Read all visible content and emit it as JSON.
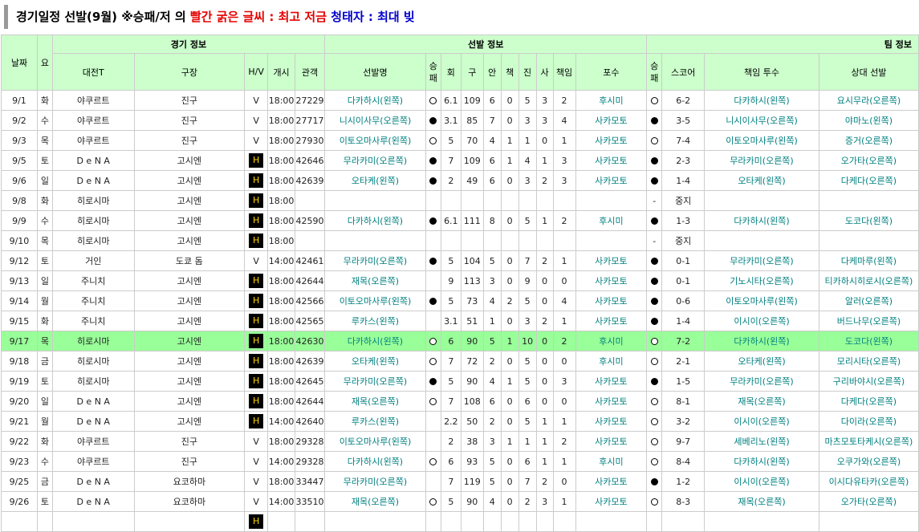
{
  "header": {
    "title_part1": "경기일정 선발(9월) ※승패/저 의 ",
    "title_red": "빨간 굵은 글씨 : 최고 저금",
    "title_part2": " ",
    "title_blue": "청태자 : 최대 빚"
  },
  "table": {
    "group_headers": {
      "date": "날짜",
      "day": "요",
      "game_info": "경기 정보",
      "starter_info": "선발 정보",
      "team_info": "팀 정보"
    },
    "columns": {
      "opponent": "대전T",
      "stadium": "구장",
      "hv": "H/V",
      "start": "개시",
      "attendance": "관객",
      "starter": "선발명",
      "decision": "승패",
      "innings": "회",
      "pitches": "구",
      "hits": "안",
      "er": "책",
      "ks": "진",
      "bb": "사",
      "runs": "책임",
      "catcher": "포수",
      "result": "승패",
      "score": "스코어",
      "resp_pitcher": "책임 투수",
      "opp_starter": "상대 선발"
    },
    "rows": [
      {
        "date": "9/1",
        "day": "화",
        "opp": "야쿠르트",
        "stadium": "진구",
        "hv": "V",
        "start": "18:00",
        "att": "27229",
        "starter": "다카하시(왼쪽)",
        "dec": "win",
        "inn": "6.1",
        "pit": "109",
        "hits": "6",
        "er": "0",
        "k": "5",
        "bb": "3",
        "runs": "2",
        "catcher": "후시미",
        "res": "win",
        "score": "6-2",
        "resp": "다카하시(왼쪽)",
        "opp_starter": "요시무라(오른쪽)"
      },
      {
        "date": "9/2",
        "day": "수",
        "opp": "야쿠르트",
        "stadium": "진구",
        "hv": "V",
        "start": "18:00",
        "att": "27717",
        "starter": "니시이사무(오른쪽)",
        "dec": "loss",
        "inn": "3.1",
        "pit": "85",
        "hits": "7",
        "er": "0",
        "k": "3",
        "bb": "3",
        "runs": "4",
        "catcher": "사카모토",
        "res": "loss",
        "score": "3-5",
        "resp": "니시이사무(오른쪽)",
        "opp_starter": "야마노(왼쪽)"
      },
      {
        "date": "9/3",
        "day": "목",
        "opp": "야쿠르트",
        "stadium": "진구",
        "hv": "V",
        "start": "18:00",
        "att": "27930",
        "starter": "이토오마사루(왼쪽)",
        "dec": "win",
        "inn": "5",
        "pit": "70",
        "hits": "4",
        "er": "1",
        "k": "1",
        "bb": "0",
        "runs": "1",
        "catcher": "사카모토",
        "res": "win",
        "score": "7-4",
        "resp": "이토오마사루(왼쪽)",
        "opp_starter": "증거(오른쪽)"
      },
      {
        "date": "9/5",
        "day": "토",
        "opp": "D e N A",
        "stadium": "고시엔",
        "hv": "H",
        "start": "18:00",
        "att": "42646",
        "starter": "무라카미(오른쪽)",
        "dec": "loss",
        "inn": "7",
        "pit": "109",
        "hits": "6",
        "er": "1",
        "k": "4",
        "bb": "1",
        "runs": "3",
        "catcher": "사카모토",
        "res": "loss",
        "score": "2-3",
        "resp": "무라카미(오른쪽)",
        "opp_starter": "오가타(오른쪽)"
      },
      {
        "date": "9/6",
        "day": "일",
        "opp": "D e N A",
        "stadium": "고시엔",
        "hv": "H",
        "start": "18:00",
        "att": "42639",
        "starter": "오타케(왼쪽)",
        "dec": "loss",
        "inn": "2",
        "pit": "49",
        "hits": "6",
        "er": "0",
        "k": "3",
        "bb": "2",
        "runs": "3",
        "catcher": "사카모토",
        "res": "loss",
        "score": "1-4",
        "resp": "오타케(왼쪽)",
        "opp_starter": "다케다(오른쪽)"
      },
      {
        "date": "9/8",
        "day": "화",
        "opp": "히로시마",
        "stadium": "고시엔",
        "hv": "H",
        "start": "18:00",
        "att": "",
        "starter": "",
        "dec": "",
        "inn": "",
        "pit": "",
        "hits": "",
        "er": "",
        "k": "",
        "bb": "",
        "runs": "",
        "catcher": "",
        "res": "-",
        "score": "중지",
        "resp": "",
        "opp_starter": ""
      },
      {
        "date": "9/9",
        "day": "수",
        "opp": "히로시마",
        "stadium": "고시엔",
        "hv": "H",
        "start": "18:00",
        "att": "42590",
        "starter": "다카하시(왼쪽)",
        "dec": "loss",
        "inn": "6.1",
        "pit": "111",
        "hits": "8",
        "er": "0",
        "k": "5",
        "bb": "1",
        "runs": "2",
        "catcher": "후시미",
        "res": "loss",
        "score": "1-3",
        "resp": "다카하시(왼쪽)",
        "opp_starter": "도코다(왼쪽)"
      },
      {
        "date": "9/10",
        "day": "목",
        "opp": "히로시마",
        "stadium": "고시엔",
        "hv": "H",
        "start": "18:00",
        "att": "",
        "starter": "",
        "dec": "",
        "inn": "",
        "pit": "",
        "hits": "",
        "er": "",
        "k": "",
        "bb": "",
        "runs": "",
        "catcher": "",
        "res": "-",
        "score": "중지",
        "resp": "",
        "opp_starter": ""
      },
      {
        "date": "9/12",
        "day": "토",
        "opp": "거인",
        "stadium": "도쿄 돔",
        "hv": "V",
        "start": "14:00",
        "att": "42461",
        "starter": "무라카미(오른쪽)",
        "dec": "loss",
        "inn": "5",
        "pit": "104",
        "hits": "5",
        "er": "0",
        "k": "7",
        "bb": "2",
        "runs": "1",
        "catcher": "사카모토",
        "res": "loss",
        "score": "0-1",
        "resp": "무라카미(오른쪽)",
        "opp_starter": "다케마루(왼쪽)"
      },
      {
        "date": "9/13",
        "day": "일",
        "opp": "주니치",
        "stadium": "고시엔",
        "hv": "H",
        "start": "18:00",
        "att": "42644",
        "starter": "재목(오른쪽)",
        "dec": "",
        "inn": "9",
        "pit": "113",
        "hits": "3",
        "er": "0",
        "k": "9",
        "bb": "0",
        "runs": "0",
        "catcher": "사카모토",
        "res": "loss",
        "score": "0-1",
        "resp": "기노시타(오른쪽)",
        "opp_starter": "티카하시히로시(오른쪽)"
      },
      {
        "date": "9/14",
        "day": "월",
        "opp": "주니치",
        "stadium": "고시엔",
        "hv": "H",
        "start": "18:00",
        "att": "42566",
        "starter": "이토오마사루(왼쪽)",
        "dec": "loss",
        "inn": "5",
        "pit": "73",
        "hits": "4",
        "er": "2",
        "k": "5",
        "bb": "0",
        "runs": "4",
        "catcher": "사카모토",
        "res": "loss",
        "score": "0-6",
        "resp": "이토오마사루(왼쪽)",
        "opp_starter": "알러(오른쪽)"
      },
      {
        "date": "9/15",
        "day": "화",
        "opp": "주니치",
        "stadium": "고시엔",
        "hv": "H",
        "start": "18:00",
        "att": "42565",
        "starter": "루카스(왼쪽)",
        "dec": "",
        "inn": "3.1",
        "pit": "51",
        "hits": "1",
        "er": "0",
        "k": "3",
        "bb": "2",
        "runs": "1",
        "catcher": "사카모토",
        "res": "loss",
        "score": "1-4",
        "resp": "이시이(오른쪽)",
        "opp_starter": "버드나무(오른쪽)"
      },
      {
        "date": "9/17",
        "day": "목",
        "opp": "히로시마",
        "stadium": "고시엔",
        "hv": "H",
        "start": "18:00",
        "att": "42630",
        "starter": "다카하시(왼쪽)",
        "dec": "win",
        "inn": "6",
        "pit": "90",
        "hits": "5",
        "er": "1",
        "k": "10",
        "bb": "0",
        "runs": "2",
        "catcher": "후시미",
        "res": "win",
        "score": "7-2",
        "resp": "다카하시(왼쪽)",
        "opp_starter": "도코다(왼쪽)",
        "hl": true
      },
      {
        "date": "9/18",
        "day": "금",
        "opp": "히로시마",
        "stadium": "고시엔",
        "hv": "H",
        "start": "18:00",
        "att": "42639",
        "starter": "오타케(왼쪽)",
        "dec": "win",
        "inn": "7",
        "pit": "72",
        "hits": "2",
        "er": "0",
        "k": "5",
        "bb": "0",
        "runs": "0",
        "catcher": "후시미",
        "res": "win",
        "score": "2-1",
        "resp": "오타케(왼쪽)",
        "opp_starter": "모리시타(오른쪽)"
      },
      {
        "date": "9/19",
        "day": "토",
        "opp": "히로시마",
        "stadium": "고시엔",
        "hv": "H",
        "start": "18:00",
        "att": "42645",
        "starter": "무라카미(오른쪽)",
        "dec": "loss",
        "inn": "5",
        "pit": "90",
        "hits": "4",
        "er": "1",
        "k": "5",
        "bb": "0",
        "runs": "3",
        "catcher": "사카모토",
        "res": "loss",
        "score": "1-5",
        "resp": "무라카미(오른쪽)",
        "opp_starter": "구리바야시(오른쪽)"
      },
      {
        "date": "9/20",
        "day": "일",
        "opp": "D e N A",
        "stadium": "고시엔",
        "hv": "H",
        "start": "18:00",
        "att": "42644",
        "starter": "재목(오른쪽)",
        "dec": "win",
        "inn": "7",
        "pit": "108",
        "hits": "6",
        "er": "0",
        "k": "6",
        "bb": "0",
        "runs": "0",
        "catcher": "사카모토",
        "res": "win",
        "score": "8-1",
        "resp": "재목(오른쪽)",
        "opp_starter": "다케다(오른쪽)"
      },
      {
        "date": "9/21",
        "day": "월",
        "opp": "D e N A",
        "stadium": "고시엔",
        "hv": "H",
        "start": "14:00",
        "att": "42640",
        "starter": "루카스(왼쪽)",
        "dec": "",
        "inn": "2.2",
        "pit": "50",
        "hits": "2",
        "er": "0",
        "k": "5",
        "bb": "1",
        "runs": "1",
        "catcher": "사카모토",
        "res": "win",
        "score": "3-2",
        "resp": "이시이(오른쪽)",
        "opp_starter": "다이라(오른쪽)"
      },
      {
        "date": "9/22",
        "day": "화",
        "opp": "야쿠르트",
        "stadium": "진구",
        "hv": "V",
        "start": "18:00",
        "att": "29328",
        "starter": "이토오마사루(왼쪽)",
        "dec": "",
        "inn": "2",
        "pit": "38",
        "hits": "3",
        "er": "1",
        "k": "1",
        "bb": "1",
        "runs": "2",
        "catcher": "사카모토",
        "res": "win",
        "score": "9-7",
        "resp": "세베리노(왼쪽)",
        "opp_starter": "마츠모토타케시(오른쪽)"
      },
      {
        "date": "9/23",
        "day": "수",
        "opp": "야쿠르트",
        "stadium": "진구",
        "hv": "V",
        "start": "14:00",
        "att": "29328",
        "starter": "다카하시(왼쪽)",
        "dec": "win",
        "inn": "6",
        "pit": "93",
        "hits": "5",
        "er": "0",
        "k": "6",
        "bb": "1",
        "runs": "1",
        "catcher": "후시미",
        "res": "win",
        "score": "8-4",
        "resp": "다카하시(왼쪽)",
        "opp_starter": "오쿠가와(오른쪽)"
      },
      {
        "date": "9/25",
        "day": "금",
        "opp": "D e N A",
        "stadium": "요코하마",
        "hv": "V",
        "start": "18:00",
        "att": "33447",
        "starter": "무라카미(오른쪽)",
        "dec": "",
        "inn": "7",
        "pit": "119",
        "hits": "5",
        "er": "0",
        "k": "7",
        "bb": "2",
        "runs": "0",
        "catcher": "사카모토",
        "res": "loss",
        "score": "1-2",
        "resp": "이시이(오른쪽)",
        "opp_starter": "이시다유타카(오른쪽)"
      },
      {
        "date": "9/26",
        "day": "토",
        "opp": "D e N A",
        "stadium": "요코하마",
        "hv": "V",
        "start": "14:00",
        "att": "33510",
        "starter": "재목(오른쪽)",
        "dec": "win",
        "inn": "5",
        "pit": "90",
        "hits": "4",
        "er": "0",
        "k": "2",
        "bb": "3",
        "runs": "1",
        "catcher": "사카모토",
        "res": "win",
        "score": "8-3",
        "resp": "재목(오른쪽)",
        "opp_starter": "오가타(오른쪽)"
      },
      {
        "date": "",
        "day": "",
        "opp": "",
        "stadium": "",
        "hv": "H",
        "start": "",
        "att": "",
        "starter": "",
        "dec": "",
        "inn": "",
        "pit": "",
        "hits": "",
        "er": "",
        "k": "",
        "bb": "",
        "runs": "",
        "catcher": "",
        "res": "",
        "score": "",
        "resp": "",
        "opp_starter": ""
      }
    ]
  }
}
